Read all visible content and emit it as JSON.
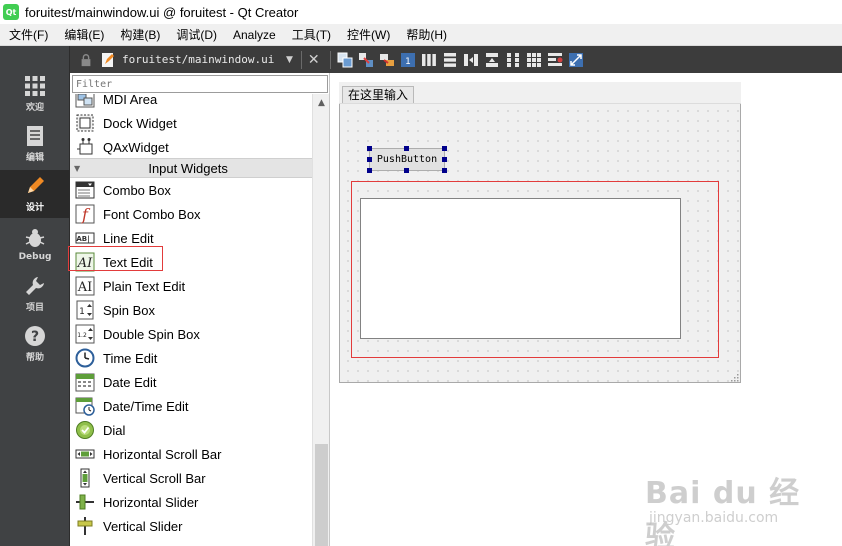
{
  "window": {
    "title": "foruitest/mainwindow.ui @ foruitest - Qt Creator",
    "app_icon_text": "Qt"
  },
  "menubar": {
    "items": [
      "文件(F)",
      "编辑(E)",
      "构建(B)",
      "调试(D)",
      "Analyze",
      "工具(T)",
      "控件(W)",
      "帮助(H)"
    ]
  },
  "modes": [
    {
      "name": "welcome",
      "label": "欢迎",
      "icon": "grid-icon",
      "active": false
    },
    {
      "name": "edit",
      "label": "编辑",
      "icon": "document-icon",
      "active": false
    },
    {
      "name": "design",
      "label": "设计",
      "icon": "pencil-icon",
      "active": true
    },
    {
      "name": "debug",
      "label": "Debug",
      "icon": "bug-icon",
      "active": false
    },
    {
      "name": "projects",
      "label": "项目",
      "icon": "wrench-icon",
      "active": false
    },
    {
      "name": "help",
      "label": "帮助",
      "icon": "help-icon",
      "active": false
    }
  ],
  "editor_toolbar": {
    "file_name": "foruitest/mainwindow.ui",
    "tools": [
      "edit-widgets-icon",
      "edit-signals-icon",
      "edit-buddies-icon",
      "edit-tab-order-icon",
      "layout-horizontal-icon",
      "layout-vertical-icon",
      "layout-h-splitter-icon",
      "layout-v-splitter-icon",
      "layout-form-icon",
      "layout-grid-icon",
      "break-layout-icon",
      "adjust-size-icon"
    ]
  },
  "widget_box": {
    "filter_placeholder": "Filter",
    "items_before": [
      {
        "label": "MDI Area",
        "icon": "mdi-area-icon"
      },
      {
        "label": "Dock Widget",
        "icon": "dock-widget-icon"
      },
      {
        "label": "QAxWidget",
        "icon": "qaxwidget-icon"
      }
    ],
    "category": "Input Widgets",
    "items": [
      {
        "label": "Combo Box",
        "icon": "combo-box-icon"
      },
      {
        "label": "Font Combo Box",
        "icon": "font-combo-box-icon"
      },
      {
        "label": "Line Edit",
        "icon": "line-edit-icon"
      },
      {
        "label": "Text Edit",
        "icon": "text-edit-icon"
      },
      {
        "label": "Plain Text Edit",
        "icon": "plain-text-edit-icon"
      },
      {
        "label": "Spin Box",
        "icon": "spin-box-icon"
      },
      {
        "label": "Double Spin Box",
        "icon": "double-spin-box-icon"
      },
      {
        "label": "Time Edit",
        "icon": "time-edit-icon"
      },
      {
        "label": "Date Edit",
        "icon": "date-edit-icon"
      },
      {
        "label": "Date/Time Edit",
        "icon": "date-time-edit-icon"
      },
      {
        "label": "Dial",
        "icon": "dial-icon"
      },
      {
        "label": "Horizontal Scroll Bar",
        "icon": "horizontal-scroll-bar-icon"
      },
      {
        "label": "Vertical Scroll Bar",
        "icon": "vertical-scroll-bar-icon"
      },
      {
        "label": "Horizontal Slider",
        "icon": "horizontal-slider-icon"
      },
      {
        "label": "Vertical Slider",
        "icon": "vertical-slider-icon"
      }
    ]
  },
  "form": {
    "menu_entry": "在这里输入",
    "push_button": "PushButton"
  },
  "watermark": {
    "logo": "Bai du 经验",
    "url": "jingyan.baidu.com"
  },
  "colors": {
    "modebar_bg": "#404244",
    "highlight_red": "#e23b3b",
    "selection_handle": "#00008b"
  }
}
